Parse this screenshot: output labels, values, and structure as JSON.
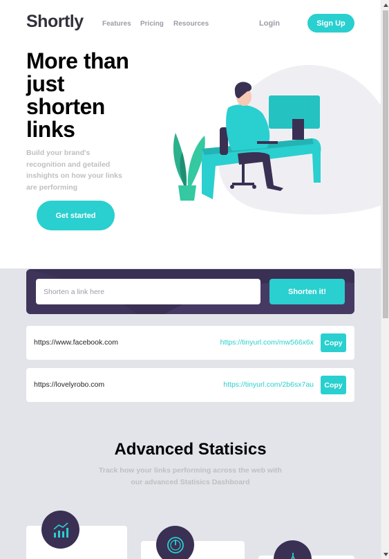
{
  "header": {
    "logo": "Shortly",
    "nav": [
      "Features",
      "Pricing",
      "Resources"
    ],
    "login": "Login",
    "signup": "Sign Up"
  },
  "hero": {
    "title": "More than just shorten links",
    "subtitle": "Build your brand's recognition and getailed inshights on how your links are performing",
    "cta": "Get started"
  },
  "shorten": {
    "placeholder": "Shorten a link here",
    "button": "Shorten it!"
  },
  "results": [
    {
      "original": "https://www.facebook.com",
      "short": "https://tinyurl.com/mw566x6x",
      "copy": "Copy"
    },
    {
      "original": "https://lovelyrobo.com",
      "short": "https://tinyurl.com/2b6sx7au",
      "copy": "Copy"
    }
  ],
  "stats": {
    "title": "Advanced Statisics",
    "subtitle": "Track how your links performing across the web with our advanced Statisics Dashboard",
    "cards": [
      {
        "icon": "bar-chart-icon"
      },
      {
        "icon": "gauge-icon"
      },
      {
        "icon": "brush-icon"
      }
    ]
  },
  "colors": {
    "cyan": "#2acfcf",
    "dark_violet": "#3a3054",
    "gray_bg": "#e2e4ea",
    "gray_text": "#9e9aa7"
  }
}
